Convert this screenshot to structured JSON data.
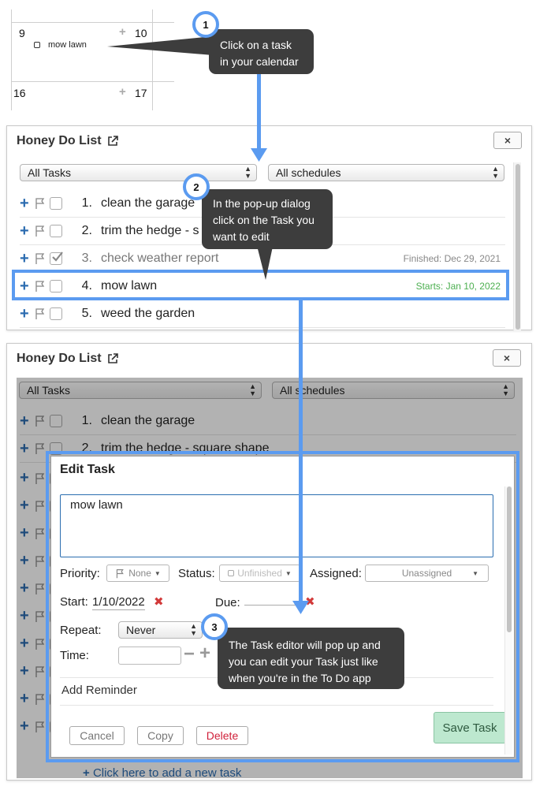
{
  "calendar": {
    "days": [
      "9",
      "10",
      "16",
      "17"
    ],
    "task": "mow lawn"
  },
  "callouts": {
    "step1": {
      "number": "1",
      "line1": "Click on a task",
      "line2": "in your calendar"
    },
    "step2": {
      "number": "2",
      "line1": "In the pop-up dialog",
      "line2": "click on the Task you",
      "line3": "want to edit"
    },
    "step3": {
      "number": "3",
      "line1": "The Task editor will pop up and",
      "line2": "you can edit your Task just like",
      "line3": "when you're in the To Do app"
    }
  },
  "dialog1": {
    "title": "Honey Do List",
    "close": "×",
    "filter_tasks": "All Tasks",
    "filter_schedules": "All schedules",
    "rows": [
      {
        "num": "1.",
        "text": "clean the garage",
        "meta": "",
        "checked": false
      },
      {
        "num": "2.",
        "text": "trim the hedge - s",
        "meta": "",
        "checked": false
      },
      {
        "num": "3.",
        "text": "check weather report",
        "meta": "Finished: Dec 29, 2021",
        "checked": true
      },
      {
        "num": "4.",
        "text": "mow lawn",
        "meta": "Starts: Jan 10, 2022",
        "checked": false
      },
      {
        "num": "5.",
        "text": "weed the garden",
        "meta": "",
        "checked": false
      }
    ]
  },
  "dialog2": {
    "title": "Honey Do List",
    "close": "×",
    "filter_tasks": "All Tasks",
    "filter_schedules": "All schedules",
    "rows": [
      {
        "num": "1.",
        "text": "clean the garage"
      },
      {
        "num": "2.",
        "text": "trim the hedge - square shape"
      }
    ],
    "add_task_link": "Click here to add a new task"
  },
  "edit_task": {
    "title": "Edit Task",
    "task_text": "mow lawn",
    "priority_label": "Priority:",
    "priority_value": "None",
    "status_label": "Status:",
    "status_value": "Unfinished",
    "assigned_label": "Assigned:",
    "assigned_value": "Unassigned",
    "start_label": "Start:",
    "start_value": "1/10/2022",
    "due_label": "Due:",
    "repeat_label": "Repeat:",
    "repeat_value": "Never",
    "time_label": "Time:",
    "add_reminder": "Add Reminder",
    "cancel": "Cancel",
    "copy": "Copy",
    "delete": "Delete",
    "save": "Save Task"
  },
  "colors": {
    "highlight": "#5b9bf0",
    "callout_bg": "#3d3d3d",
    "starts_green": "#4caf50",
    "delete_red": "#d0203a",
    "save_bg": "#bde8cf"
  }
}
